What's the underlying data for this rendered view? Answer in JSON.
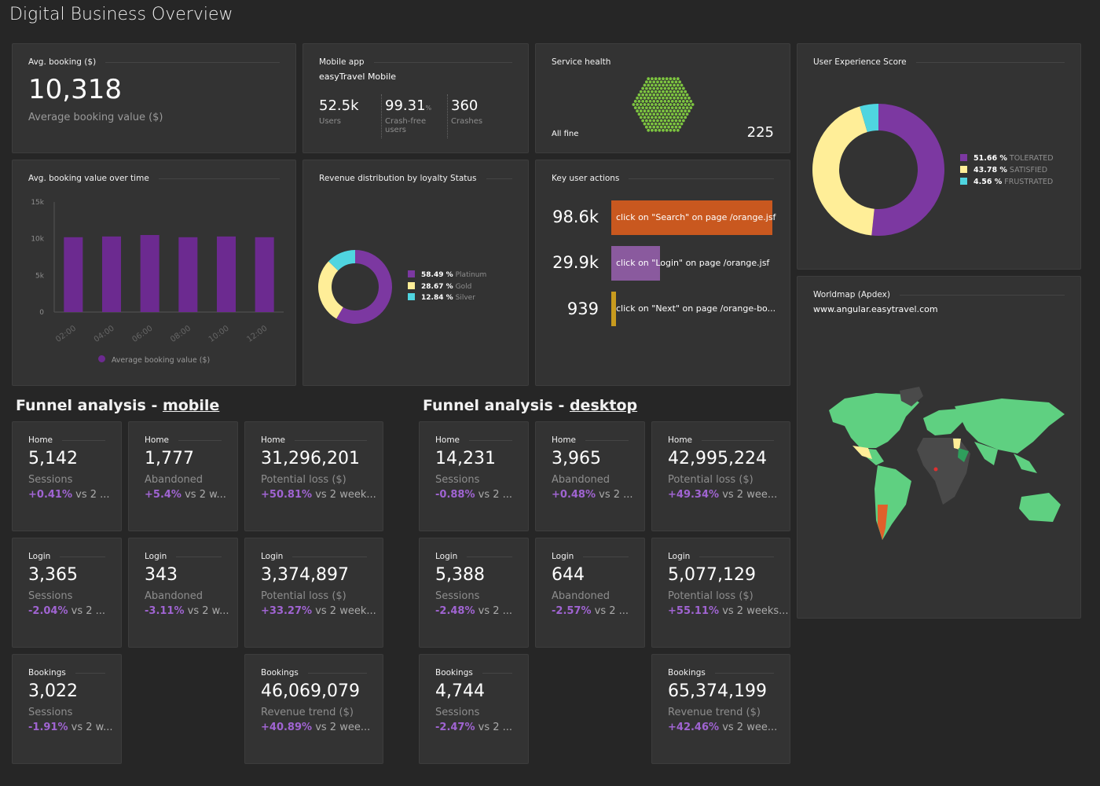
{
  "page_title": "Digital Business Overview",
  "avg_booking": {
    "title": "Avg. booking ($)",
    "value": "10,318",
    "label": "Average booking value ($)"
  },
  "mobile_app": {
    "title": "Mobile app",
    "app_name": "easyTravel Mobile",
    "users": "52.5k",
    "users_label": "Users",
    "crash_free": "99.31",
    "crash_free_unit": "%",
    "crash_free_label": "Crash-free users",
    "crashes": "360",
    "crashes_label": "Crashes"
  },
  "service_health": {
    "title": "Service health",
    "status": "All fine",
    "count": "225",
    "color": "#7dc540"
  },
  "ux_score": {
    "title": "User Experience Score",
    "items": [
      {
        "pct": "51.66 %",
        "label": "TOLERATED",
        "value": 51.66,
        "color": "#7c38a1"
      },
      {
        "pct": "43.78 %",
        "label": "SATISFIED",
        "value": 43.78,
        "color": "#ffee98"
      },
      {
        "pct": "4.56 %",
        "label": "FRUSTRATED",
        "value": 4.56,
        "color": "#4fd5e0"
      }
    ]
  },
  "chart_data": [
    {
      "type": "bar",
      "title": "Avg. booking value over time",
      "categories": [
        "02:00",
        "04:00",
        "06:00",
        "08:00",
        "10:00",
        "12:00"
      ],
      "series": [
        {
          "name": "Average booking value ($)",
          "values": [
            10200,
            10300,
            10500,
            10200,
            10300,
            10200
          ],
          "color": "#6c2a90"
        }
      ],
      "yticks": [
        "0",
        "5k",
        "10k",
        "15k"
      ],
      "ylim": [
        0,
        15000
      ],
      "legend": "bottom"
    },
    {
      "type": "pie",
      "title": "Revenue distribution by loyalty Status",
      "items": [
        {
          "pct": "58.49 %",
          "label": "Platinum",
          "value": 58.49,
          "color": "#7c38a1"
        },
        {
          "pct": "28.67 %",
          "label": "Gold",
          "value": 28.67,
          "color": "#ffee98"
        },
        {
          "pct": "12.84 %",
          "label": "Silver",
          "value": 12.84,
          "color": "#4fd5e0"
        }
      ],
      "legend": "right"
    }
  ],
  "key_actions": {
    "title": "Key user actions",
    "items": [
      {
        "count": "98.6k",
        "label": "click on \"Search\" on page /orange.jsf",
        "fill": 1.0,
        "color": "#c9581f"
      },
      {
        "count": "29.9k",
        "label": "click on \"Login\" on page /orange.jsf",
        "fill": 0.3,
        "color": "#8a5a9e"
      },
      {
        "count": "939",
        "label": "click on \"Next\" on page /orange-bo...",
        "fill": 0.01,
        "color": "#c89b1e"
      }
    ]
  },
  "worldmap": {
    "title": "Worldmap (Apdex)",
    "subtitle": "www.angular.easytravel.com"
  },
  "funnel_mobile": {
    "prefix": "Funnel analysis - ",
    "link": "mobile",
    "tiles": [
      {
        "step": "Home",
        "value": "5,142",
        "label": "Sessions",
        "change": "+0.41%",
        "rest": "vs 2 ..."
      },
      {
        "step": "Home",
        "value": "1,777",
        "label": "Abandoned",
        "change": "+5.4%",
        "rest": "vs 2 w..."
      },
      {
        "step": "Home",
        "value": "31,296,201",
        "label": "Potential loss ($)",
        "change": "+50.81%",
        "rest": "vs 2 week..."
      },
      {
        "step": "Login",
        "value": "3,365",
        "label": "Sessions",
        "change": "-2.04%",
        "rest": "vs 2 ..."
      },
      {
        "step": "Login",
        "value": "343",
        "label": "Abandoned",
        "change": "-3.11%",
        "rest": "vs 2 w..."
      },
      {
        "step": "Login",
        "value": "3,374,897",
        "label": "Potential loss ($)",
        "change": "+33.27%",
        "rest": "vs 2 week..."
      },
      {
        "step": "Bookings",
        "value": "3,022",
        "label": "Sessions",
        "change": "-1.91%",
        "rest": "vs 2 w..."
      },
      {
        "step": "Bookings",
        "value": "46,069,079",
        "label": "Revenue trend ($)",
        "change": "+40.89%",
        "rest": "vs 2 wee..."
      }
    ]
  },
  "funnel_desktop": {
    "prefix": "Funnel analysis - ",
    "link": "desktop",
    "tiles": [
      {
        "step": "Home",
        "value": "14,231",
        "label": "Sessions",
        "change": "-0.88%",
        "rest": "vs 2 ..."
      },
      {
        "step": "Home",
        "value": "3,965",
        "label": "Abandoned",
        "change": "+0.48%",
        "rest": "vs 2 ..."
      },
      {
        "step": "Home",
        "value": "42,995,224",
        "label": "Potential loss ($)",
        "change": "+49.34%",
        "rest": "vs 2 wee..."
      },
      {
        "step": "Login",
        "value": "5,388",
        "label": "Sessions",
        "change": "-2.48%",
        "rest": "vs 2 ..."
      },
      {
        "step": "Login",
        "value": "644",
        "label": "Abandoned",
        "change": "-2.57%",
        "rest": "vs 2 ..."
      },
      {
        "step": "Login",
        "value": "5,077,129",
        "label": "Potential loss ($)",
        "change": "+55.11%",
        "rest": "vs 2 weeks..."
      },
      {
        "step": "Bookings",
        "value": "4,744",
        "label": "Sessions",
        "change": "-2.47%",
        "rest": "vs 2 ..."
      },
      {
        "step": "Bookings",
        "value": "65,374,199",
        "label": "Revenue trend ($)",
        "change": "+42.46%",
        "rest": "vs 2 wee..."
      }
    ]
  }
}
